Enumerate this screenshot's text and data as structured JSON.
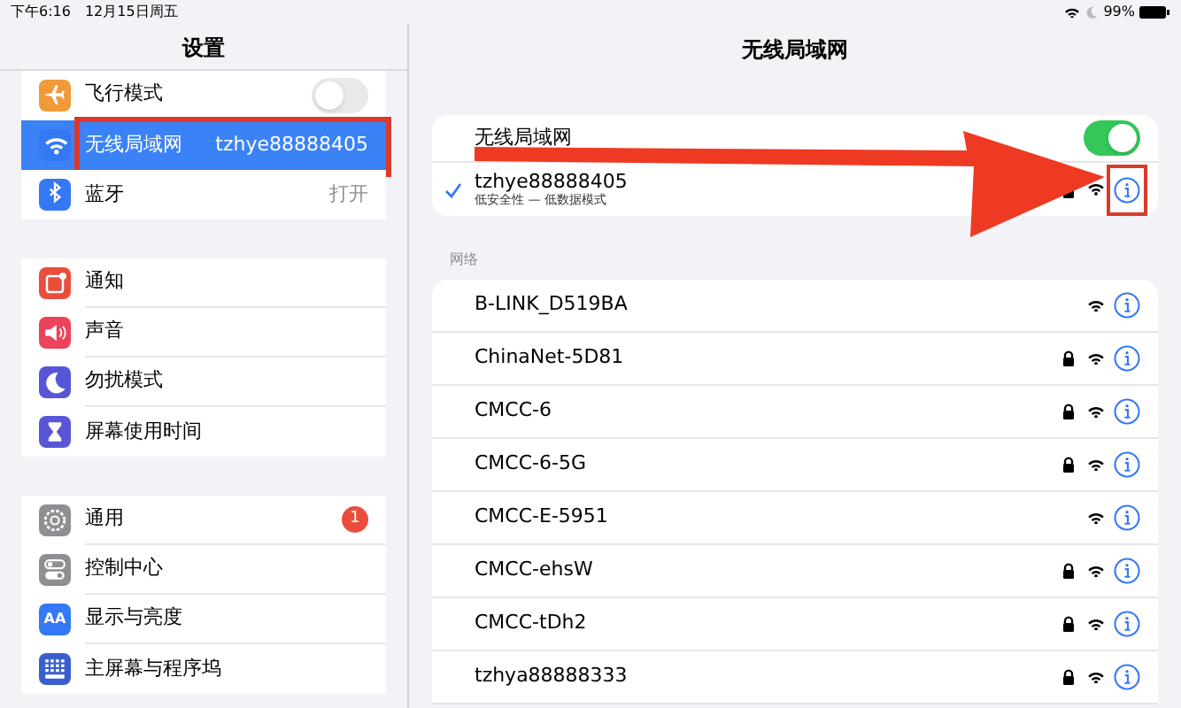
{
  "status_bar": {
    "time": "下午6:16",
    "date": "12月15日周五",
    "battery": "99%"
  },
  "sidebar": {
    "title": "设置",
    "groups": [
      {
        "items": [
          {
            "label": "飞行模式",
            "kind": "toggle",
            "on": false,
            "selected": false,
            "highlighted": false
          },
          {
            "label": "无线局域网",
            "kind": "value",
            "value": "tzhye88888405",
            "selected": true,
            "highlighted": true
          },
          {
            "label": "蓝牙",
            "kind": "value",
            "value": "打开",
            "selected": false,
            "highlighted": false
          }
        ]
      },
      {
        "items": [
          {
            "label": "通知",
            "kind": "plain",
            "selected": false,
            "highlighted": false
          },
          {
            "label": "声音",
            "kind": "plain",
            "selected": false,
            "highlighted": false
          },
          {
            "label": "勿扰模式",
            "kind": "plain",
            "selected": false,
            "highlighted": false
          },
          {
            "label": "屏幕使用时间",
            "kind": "plain",
            "selected": false,
            "highlighted": false
          }
        ]
      },
      {
        "items": [
          {
            "label": "通用",
            "kind": "badge",
            "badge": "1",
            "selected": false,
            "highlighted": false
          },
          {
            "label": "控制中心",
            "kind": "plain",
            "selected": false,
            "highlighted": false
          },
          {
            "label": "显示与亮度",
            "icon_text": "AA",
            "kind": "plain",
            "selected": false,
            "highlighted": false
          },
          {
            "label": "主屏幕与程序坞",
            "kind": "plain",
            "selected": false,
            "highlighted": false
          }
        ]
      }
    ]
  },
  "detail": {
    "title": "无线局域网",
    "wifi_toggle": {
      "label": "无线局域网",
      "on": true
    },
    "connected": {
      "name": "tzhye88888405",
      "subtitle": "低安全性 — 低数据模式",
      "checked": true,
      "locked": true,
      "highlighted": true
    },
    "networks_header": "网络",
    "networks": [
      {
        "name": "B-LINK_D519BA",
        "locked": false
      },
      {
        "name": "ChinaNet-5D81",
        "locked": true
      },
      {
        "name": "CMCC-6",
        "locked": true
      },
      {
        "name": "CMCC-6-5G",
        "locked": true
      },
      {
        "name": "CMCC-E-5951",
        "locked": false
      },
      {
        "name": "CMCC-ehsW",
        "locked": true
      },
      {
        "name": "CMCC-tDh2",
        "locked": true
      },
      {
        "name": "tzhya88888333",
        "locked": true
      }
    ]
  }
}
